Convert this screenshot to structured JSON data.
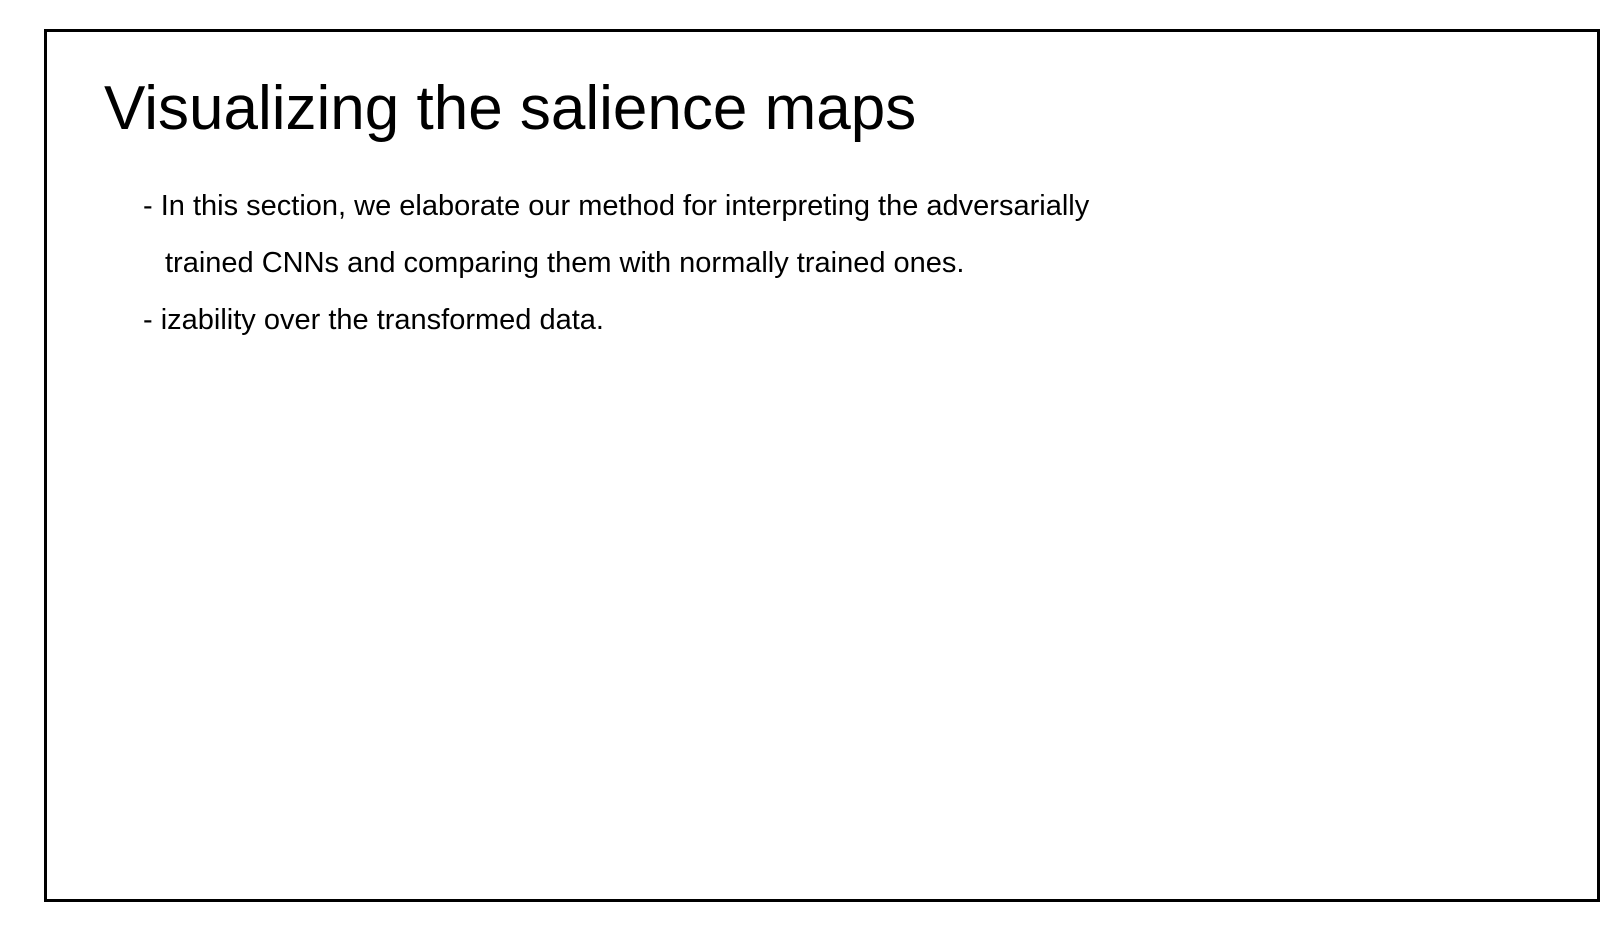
{
  "slide": {
    "title": "Visualizing the salience maps",
    "bullets": [
      {
        "line1": "- In this section, we elaborate our method for interpreting the adversarially",
        "line2": "trained CNNs and comparing them with normally trained ones."
      },
      {
        "line1": "- izability over the transformed data."
      }
    ]
  }
}
